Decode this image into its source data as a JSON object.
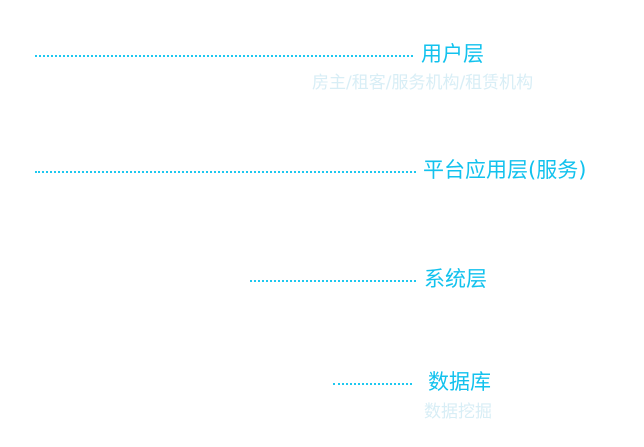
{
  "layers": [
    {
      "title": "用户层",
      "subtitle": "房主/租客/服务机构/租赁机构"
    },
    {
      "title": "平台应用层(服务)",
      "subtitle": ""
    },
    {
      "title": "系统层",
      "subtitle": ""
    },
    {
      "title": "数据库",
      "subtitle": "数据挖掘"
    }
  ],
  "colors": {
    "title": "#12c2ee",
    "subtitle": "#d8eef6",
    "leader": "#1ec8f0"
  }
}
